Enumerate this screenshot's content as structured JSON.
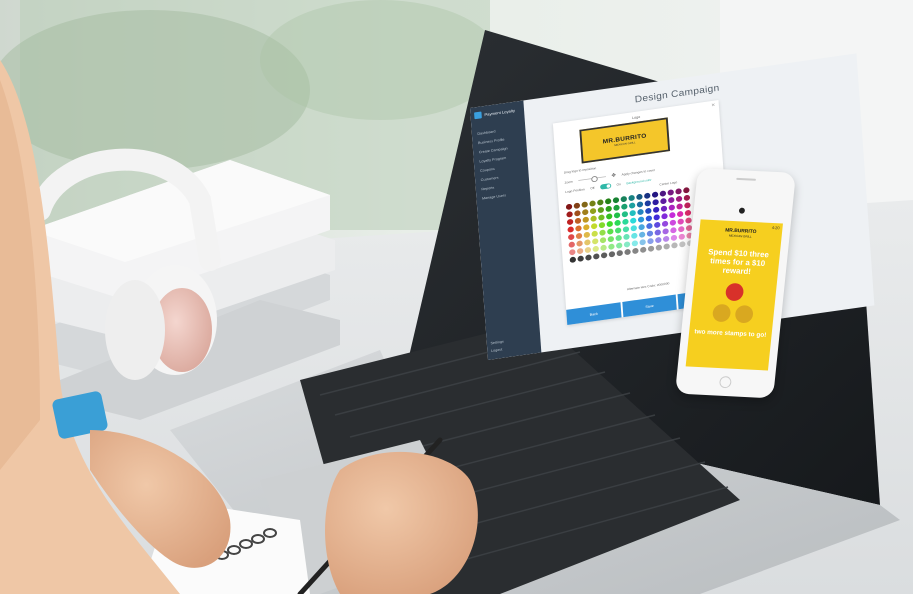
{
  "sidebar": {
    "brand": "Payment Loyalty",
    "items": [
      "Dashboard",
      "Business Profile",
      "Create Campaign",
      "Loyalty Program",
      "Coupons",
      "Customers",
      "Reports",
      "Manage Users"
    ],
    "bottom_items": [
      "Settings",
      "Logout"
    ]
  },
  "main": {
    "page_title": "Design Campaign",
    "dialog": {
      "title": "Logo",
      "close_glyph": "×",
      "logo_text_line1": "MR.BURRITO",
      "logo_text_line2": "MEXICAN GRILL",
      "drag_hint": "Drag logo to reposition",
      "zoom_label": "Zoom",
      "apply_label": "Apply changes to cover",
      "logo_position_label": "Logo Position",
      "toggle_off": "Off",
      "toggle_on": "On",
      "background_color_label": "Background color",
      "center_label": "Center Logo",
      "hex_label": "Alternate Hex Code: #000000",
      "buttons": [
        "Back",
        "Save",
        "Next"
      ]
    }
  },
  "phone": {
    "time": "4:20",
    "logo_line1": "MR.BURRITO",
    "logo_line2": "MEXICAN GRILL",
    "promo": "Spend $10 three times for a $10 reward!",
    "remaining": "two more stamps to go!"
  },
  "colors": {
    "accent_blue": "#2f8fd8",
    "teal": "#30b8a8",
    "brand_yellow": "#f4c62a",
    "sidebar_dark": "#2e3e50"
  }
}
